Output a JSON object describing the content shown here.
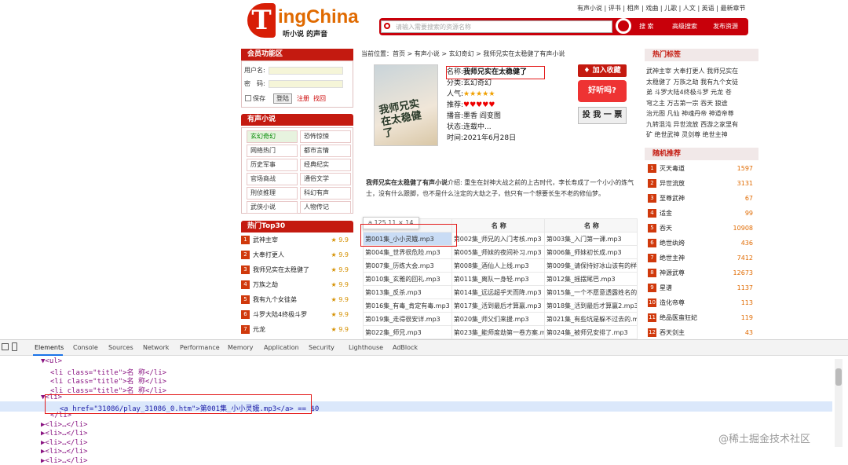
{
  "site": {
    "logo_letter": "T",
    "logo_word": "ingChina",
    "logo_sub": "听小说 的声音",
    "toplinks": "有声小说 | 评书 | 相声 | 戏曲 | 儿歌 | 人文 | 英语 | 最新章节",
    "search_placeholder": "请输入需要搜索的资源名称",
    "search_btn": "搜 索",
    "adv_search": "高级搜索",
    "publish": "发布资源"
  },
  "member": {
    "title": "会员功能区",
    "user_label": "用户名:",
    "pwd_label": "密　码:",
    "remember": "保存",
    "login": "登陆",
    "register": "注册",
    "forgot": "找回"
  },
  "novel_cats": {
    "title": "有声小说",
    "items": [
      "玄幻奇幻",
      "恐怖惊悚",
      "网络热门",
      "都市言情",
      "历史军事",
      "经典纪实",
      "官场商战",
      "通俗文学",
      "刑侦推理",
      "科幻有声",
      "武侠小说",
      "人物传记"
    ]
  },
  "top30": {
    "title": "热门Top30",
    "items": [
      {
        "n": "1",
        "name": "武神主宰",
        "score": "9.9"
      },
      {
        "n": "2",
        "name": "大奉打更人",
        "score": "9.9"
      },
      {
        "n": "3",
        "name": "我师兄实在太稳健了",
        "score": "9.9"
      },
      {
        "n": "4",
        "name": "万族之劫",
        "score": "9.9"
      },
      {
        "n": "5",
        "name": "我有九个女徒弟",
        "score": "9.9"
      },
      {
        "n": "6",
        "name": "斗罗大陆4终极斗罗",
        "score": "9.9"
      },
      {
        "n": "7",
        "name": "元龙",
        "score": "9.9"
      }
    ]
  },
  "breadcrumb": "当前位置：首页 > 有声小说 > 玄幻奇幻 > 我师兄实在太稳健了有声小说",
  "book": {
    "cover_text": "我师兄实在太稳健了",
    "name_label": "名称:",
    "name": "我师兄实在太稳健了",
    "cat_label": "分类:",
    "cat": "玄幻奇幻",
    "pop_label": "人气:",
    "stars": "★★★★★",
    "rec_label": "推荐:",
    "hearts": "♥♥♥♥♥",
    "host_label": "播音:",
    "host": "墨香 阎变图",
    "author_label": "作者:",
    "author": "言归正传",
    "status_label": "状态:",
    "status": "连载中...",
    "time_label": "时间:",
    "time": "2021年6月28日"
  },
  "actions": {
    "fav": "♦ 加入收藏",
    "good": "好听吗?",
    "vote": "投 我 一 票"
  },
  "desc": {
    "title": "我师兄实在太稳健了有声小说",
    "text": "介绍: 重生在封神大战之前的上古时代，李长寿成了一个小小的炼气士，没有什么跟脚，也不是什么注定的大劫之子，他只有一个想要长生不老的修仙梦。"
  },
  "tooltip": "a  125.11 × 14",
  "episodes": {
    "headers": [
      "名 称",
      "名 称",
      "名 称"
    ],
    "rows": [
      [
        "第001集_小小灵娥.mp3",
        "第002集_师兄的入门考核.mp3",
        "第003集_入门第一课.mp3"
      ],
      [
        "第004集_世界很危险.mp3",
        "第005集_师妹的夜间补习.mp3",
        "第006集_师妹初长成.mp3"
      ],
      [
        "第007集_历练大会.mp3",
        "第008集_酒仙人上线.mp3",
        "第009集_请保持好冰山该有的样子"
      ],
      [
        "第010集_玄雅的回礼.mp3",
        "第011集_离队一身轻.mp3",
        "第012集_摇摆尾巴.mp3"
      ],
      [
        "第013集_反杀.mp3",
        "第014集_远远超乎天而降.mp3",
        "第015集_一个不愿意透露姓名的"
      ],
      [
        "第016集_有毒_肯定有毒.mp3",
        "第017集_活到最后才算赢.mp3",
        "第018集_活到最后才算赢2.mp3"
      ],
      [
        "第019集_走得很安详.mp3",
        "第020集_师父们来援.mp3",
        "第021集_有些坑是躲不过去的.mp3"
      ],
      [
        "第022集_师兄.mp3",
        "第023集_能师度劫第一卷方案.mp3",
        "第024集_被师兄安排了.mp3"
      ]
    ]
  },
  "hot_tags": {
    "title": "热门标签",
    "lines": [
      "武神主宰  大奉打更人  我师兄实在",
      "太稳健了  万族之劫  我有九个女徒",
      "弟  斗罗大陆4终极斗罗  元龙  苍",
      "穹之主  万古第一宗  吞天  狼途",
      "治元图  凡仙  神魂丹帝  神道帝尊",
      "九转混沌  异世流放  西游之家里有",
      "矿  绝世武神  灵剑尊  绝世主神"
    ]
  },
  "random": {
    "title": "随机推荐",
    "items": [
      {
        "n": "1",
        "name": "灭天毒道",
        "v": "1597"
      },
      {
        "n": "2",
        "name": "异世流放",
        "v": "3131"
      },
      {
        "n": "3",
        "name": "至尊武神",
        "v": "67"
      },
      {
        "n": "4",
        "name": "适金",
        "v": "99"
      },
      {
        "n": "5",
        "name": "吞天",
        "v": "10908"
      },
      {
        "n": "6",
        "name": "绝世纨绔",
        "v": "436"
      },
      {
        "n": "7",
        "name": "绝世主神",
        "v": "7412"
      },
      {
        "n": "8",
        "name": "神源武尊",
        "v": "12673"
      },
      {
        "n": "9",
        "name": "星谱",
        "v": "1137"
      },
      {
        "n": "10",
        "name": "造化帝尊",
        "v": "113"
      },
      {
        "n": "11",
        "name": "绝品医蛮狂妃",
        "v": "119"
      },
      {
        "n": "12",
        "name": "吞天剑主",
        "v": "43"
      }
    ]
  },
  "devtools": {
    "tabs": [
      "Elements",
      "Console",
      "Sources",
      "Network",
      "Performance",
      "Memory",
      "Application",
      "Security",
      "Lighthouse",
      "AdBlock"
    ],
    "lines": [
      {
        "pre": "▼<ul>",
        "indent": 0
      },
      {
        "pre": "<li class=\"title\">名 称</li>",
        "indent": 1
      },
      {
        "pre": "<li class=\"title\">名 称</li>",
        "indent": 1
      },
      {
        "pre": "<li class=\"title\">名 称</li>",
        "indent": 1
      },
      {
        "pre": "▼<li>",
        "indent": 0
      },
      {
        "pre": "<a href=\"31086/play_31086_0.htm\">第001集_小小灵娥.mp3</a> == $0",
        "indent": 2
      },
      {
        "pre": "</li>",
        "indent": 1
      },
      {
        "pre": "▶<li>…</li>",
        "indent": 0
      },
      {
        "pre": "▶<li>…</li>",
        "indent": 0
      },
      {
        "pre": "▶<li>…</li>",
        "indent": 0
      },
      {
        "pre": "▶<li>…</li>",
        "indent": 0
      },
      {
        "pre": "▶<li>…</li>",
        "indent": 0
      }
    ]
  },
  "watermark": "@稀土掘金技术社区"
}
